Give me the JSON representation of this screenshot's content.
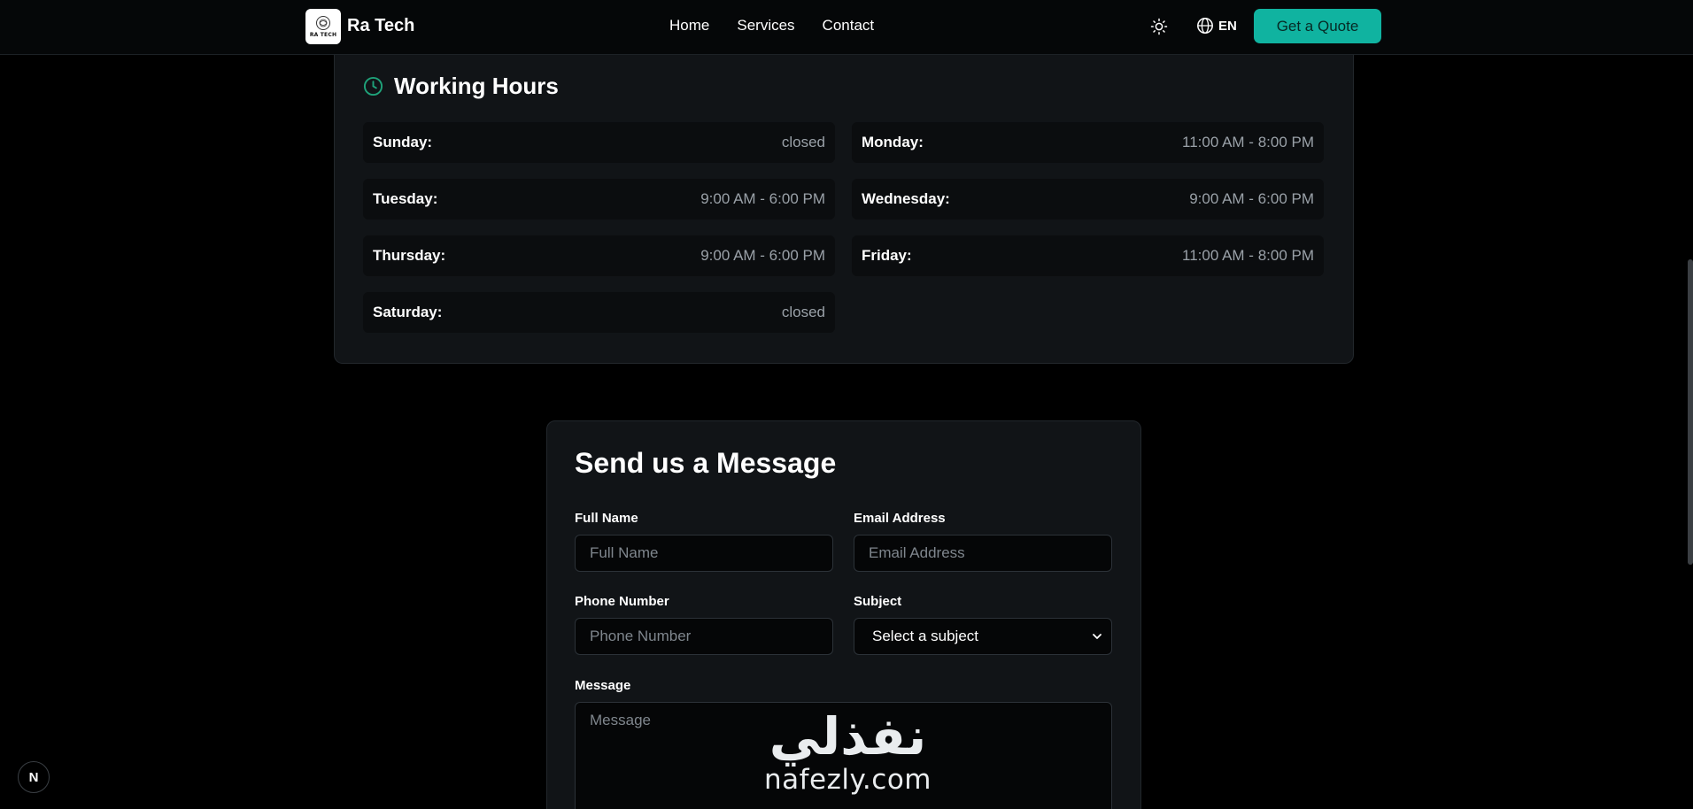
{
  "header": {
    "logo_text": "RA TECH",
    "brand": "Ra Tech",
    "nav": [
      {
        "label": "Home"
      },
      {
        "label": "Services"
      },
      {
        "label": "Contact"
      }
    ],
    "language": "EN",
    "cta": "Get a Quote"
  },
  "working_hours": {
    "title": "Working Hours",
    "days": [
      {
        "day": "Sunday:",
        "time": "closed"
      },
      {
        "day": "Monday:",
        "time": "11:00 AM - 8:00 PM"
      },
      {
        "day": "Tuesday:",
        "time": "9:00 AM - 6:00 PM"
      },
      {
        "day": "Wednesday:",
        "time": "9:00 AM - 6:00 PM"
      },
      {
        "day": "Thursday:",
        "time": "9:00 AM - 6:00 PM"
      },
      {
        "day": "Friday:",
        "time": "11:00 AM - 8:00 PM"
      },
      {
        "day": "Saturday:",
        "time": "closed"
      }
    ]
  },
  "contact_form": {
    "title": "Send us a Message",
    "full_name": {
      "label": "Full Name",
      "placeholder": "Full Name"
    },
    "email": {
      "label": "Email Address",
      "placeholder": "Email Address"
    },
    "phone": {
      "label": "Phone Number",
      "placeholder": "Phone Number"
    },
    "subject": {
      "label": "Subject",
      "value": "Select a subject"
    },
    "message": {
      "label": "Message",
      "placeholder": "Message"
    }
  },
  "watermark": {
    "arabic": "نفذلي",
    "latin": "nafezly.com"
  },
  "badge": "N",
  "colors": {
    "accent": "#10b3a0",
    "icon_accent": "#1fa37a",
    "card_bg": "#111417",
    "page_bg": "#000000"
  }
}
